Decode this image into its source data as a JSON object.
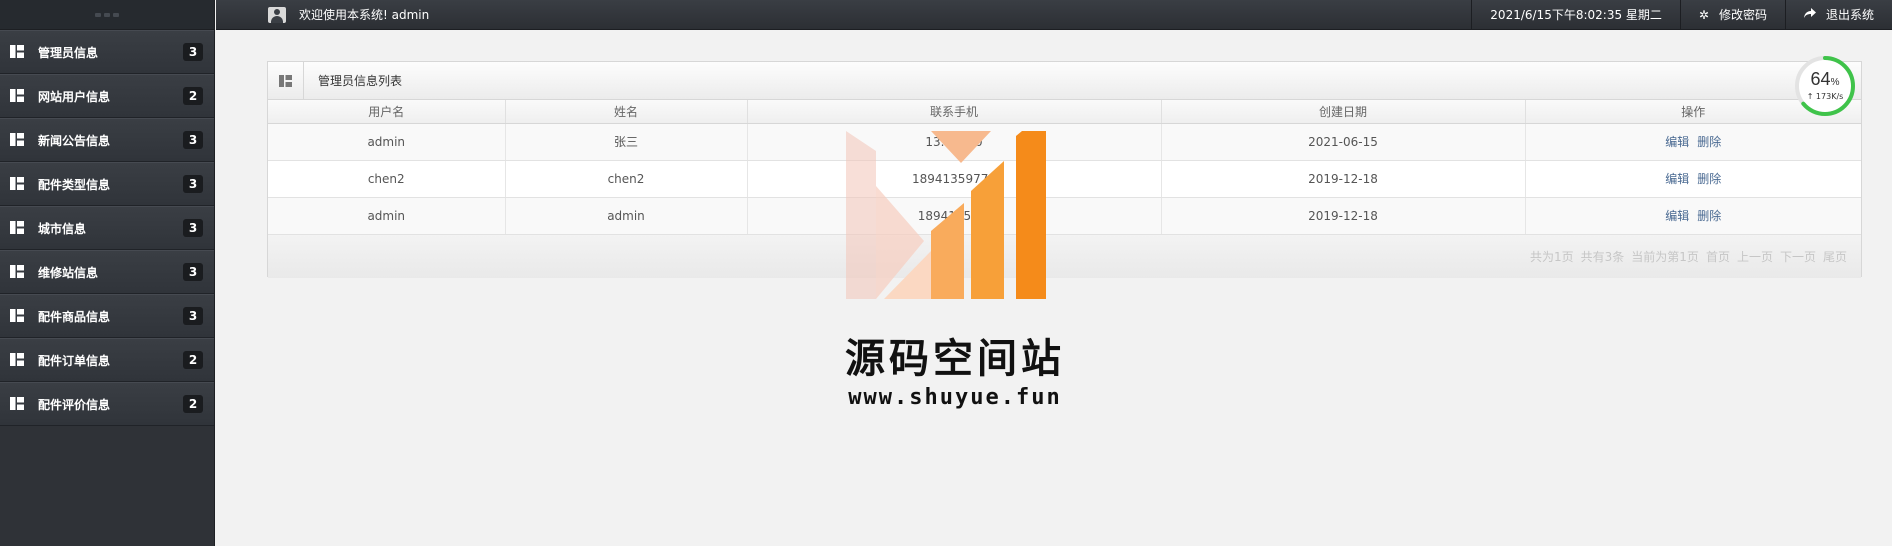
{
  "topbar": {
    "welcome": "欢迎使用本系统! admin",
    "datetime": "2021/6/15下午8:02:35 星期二",
    "change_password": "修改密码",
    "logout": "退出系统"
  },
  "sidebar": {
    "items": [
      {
        "label": "管理员信息",
        "count": "3"
      },
      {
        "label": "网站用户信息",
        "count": "2"
      },
      {
        "label": "新闻公告信息",
        "count": "3"
      },
      {
        "label": "配件类型信息",
        "count": "3"
      },
      {
        "label": "城市信息",
        "count": "3"
      },
      {
        "label": "维修站信息",
        "count": "3"
      },
      {
        "label": "配件商品信息",
        "count": "3"
      },
      {
        "label": "配件订单信息",
        "count": "2"
      },
      {
        "label": "配件评价信息",
        "count": "2"
      }
    ]
  },
  "panel": {
    "title": "管理员信息列表",
    "columns": [
      "用户名",
      "姓名",
      "联系手机",
      "创建日期",
      "操作"
    ],
    "rows": [
      {
        "username": "admin",
        "name": "张三",
        "phone": "13...8990",
        "date": "2021-06-15",
        "edit": "编辑",
        "delete": "删除"
      },
      {
        "username": "chen2",
        "name": "chen2",
        "phone": "18941359779",
        "date": "2019-12-18",
        "edit": "编辑",
        "delete": "删除"
      },
      {
        "username": "admin",
        "name": "admin",
        "phone": "18941359...",
        "date": "2019-12-18",
        "edit": "编辑",
        "delete": "删除"
      }
    ],
    "pagination": {
      "total_pages": "共为1页",
      "total_records": "共有3条",
      "current": "当前为第1页",
      "first": "首页",
      "prev": "上一页",
      "next": "下一页",
      "last": "尾页"
    }
  },
  "speed_widget": {
    "percent": "64",
    "percent_unit": "%",
    "value": 64,
    "rate": "↑ 173K/s"
  },
  "watermark": {
    "title": "源码空间站",
    "url": "www.shuyue.fun"
  },
  "colors": {
    "sidebar_bg": "#2f3237",
    "topbar_bg": "#33363b",
    "link": "#4a6a92",
    "accent_green": "#3fc34a",
    "watermark_orange": "#f7931e"
  },
  "icons": {
    "sidebar": "grid-icon",
    "topbar_user": "user-icon",
    "settings": "gear-icon",
    "logout": "share-arrow-icon",
    "panel": "grid-icon"
  }
}
